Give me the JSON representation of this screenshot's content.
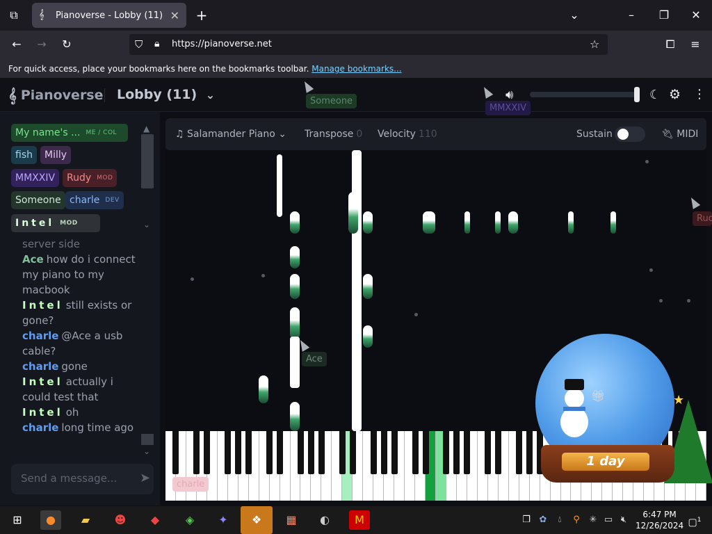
{
  "browser": {
    "tab_title": "Pianoverse - Lobby (11)",
    "url": "https://pianoverse.net",
    "bookmarks_text": "For quick access, place your bookmarks here on the bookmarks toolbar.",
    "bookmarks_link": "Manage bookmarks..."
  },
  "app": {
    "logo": "Pianoverse",
    "room": "Lobby (11)"
  },
  "users": [
    {
      "name": "My name's ...",
      "tag": "ME / COL",
      "bg": "#1c4a2a",
      "color": "#7be38f"
    },
    {
      "name": "fish",
      "tag": "",
      "bg": "#1b3b4a",
      "color": "#9fd9f0"
    },
    {
      "name": "Milly",
      "tag": "",
      "bg": "#3b2a4a",
      "color": "#e4c6f2"
    },
    {
      "name": "MMXXIV",
      "tag": "",
      "bg": "#32215a",
      "color": "#b9a6ff"
    },
    {
      "name": "Rudy",
      "tag": "MOD",
      "bg": "#4a2028",
      "color": "#f08a8a"
    },
    {
      "name": "Someone",
      "tag": "",
      "bg": "#24352c",
      "color": "#cfe7d6"
    },
    {
      "name": "charle",
      "tag": "DEV",
      "bg": "#1f2e4a",
      "color": "#8ab8ff"
    },
    {
      "name": "Intel",
      "tag": "MOD",
      "bg": "#2f3338",
      "color": "#d8ffd8"
    }
  ],
  "chat": [
    {
      "who": "",
      "text": "server side",
      "color": "#9aa1ad"
    },
    {
      "who": "Ace",
      "text": "how do i connect my piano to my macbook",
      "color": "#7fbf9c"
    },
    {
      "who": "Intel",
      "text": "still exists or gone?",
      "color": "#c4ffbe"
    },
    {
      "who": "charle",
      "text": "@Ace a usb cable?",
      "color": "#5d9cf0"
    },
    {
      "who": "charle",
      "text": "gone",
      "color": "#5d9cf0"
    },
    {
      "who": "Intel",
      "text": "actually i could test that",
      "color": "#c4ffbe"
    },
    {
      "who": "Intel",
      "text": "oh",
      "color": "#c4ffbe"
    },
    {
      "who": "charle",
      "text": "long time ago",
      "color": "#5d9cf0"
    }
  ],
  "chat_input": {
    "placeholder": "Send a message..."
  },
  "toolbar": {
    "instrument": "Salamander Piano",
    "transpose_label": "Transpose",
    "transpose_value": "0",
    "velocity_label": "Velocity",
    "velocity_value": "110",
    "sustain_label": "Sustain",
    "midi_label": "MIDI"
  },
  "cursors": [
    {
      "name": "Someone"
    },
    {
      "name": "MMXXIV"
    },
    {
      "name": "Ace"
    },
    {
      "name": "Rudy"
    },
    {
      "name": "charle"
    }
  ],
  "globe": {
    "label": "1 day"
  },
  "taskbar": {
    "time": "6:47 PM",
    "date": "12/26/2024",
    "notif_count": "1"
  }
}
